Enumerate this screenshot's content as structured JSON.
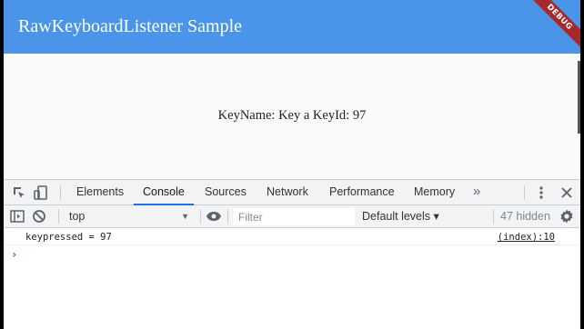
{
  "app": {
    "title": "RawKeyboardListener Sample",
    "debug_banner": "DEBUG",
    "readout": "KeyName: Key a  KeyId: 97"
  },
  "devtools": {
    "tabs": [
      {
        "label": "Elements"
      },
      {
        "label": "Console",
        "active": true
      },
      {
        "label": "Sources"
      },
      {
        "label": "Network"
      },
      {
        "label": "Performance"
      },
      {
        "label": "Memory"
      }
    ],
    "more_tabs": "»",
    "toolbar": {
      "context": "top",
      "filter_placeholder": "Filter",
      "levels": "Default levels ▾",
      "hidden": "47 hidden"
    },
    "console": {
      "messages": [
        {
          "text": "keypressed = 97",
          "source": "(index):10"
        }
      ],
      "prompt": "›"
    }
  },
  "colors": {
    "appbar": "#4a95ea",
    "debug": "#a8282c",
    "active_tab": "#1a73e8"
  }
}
